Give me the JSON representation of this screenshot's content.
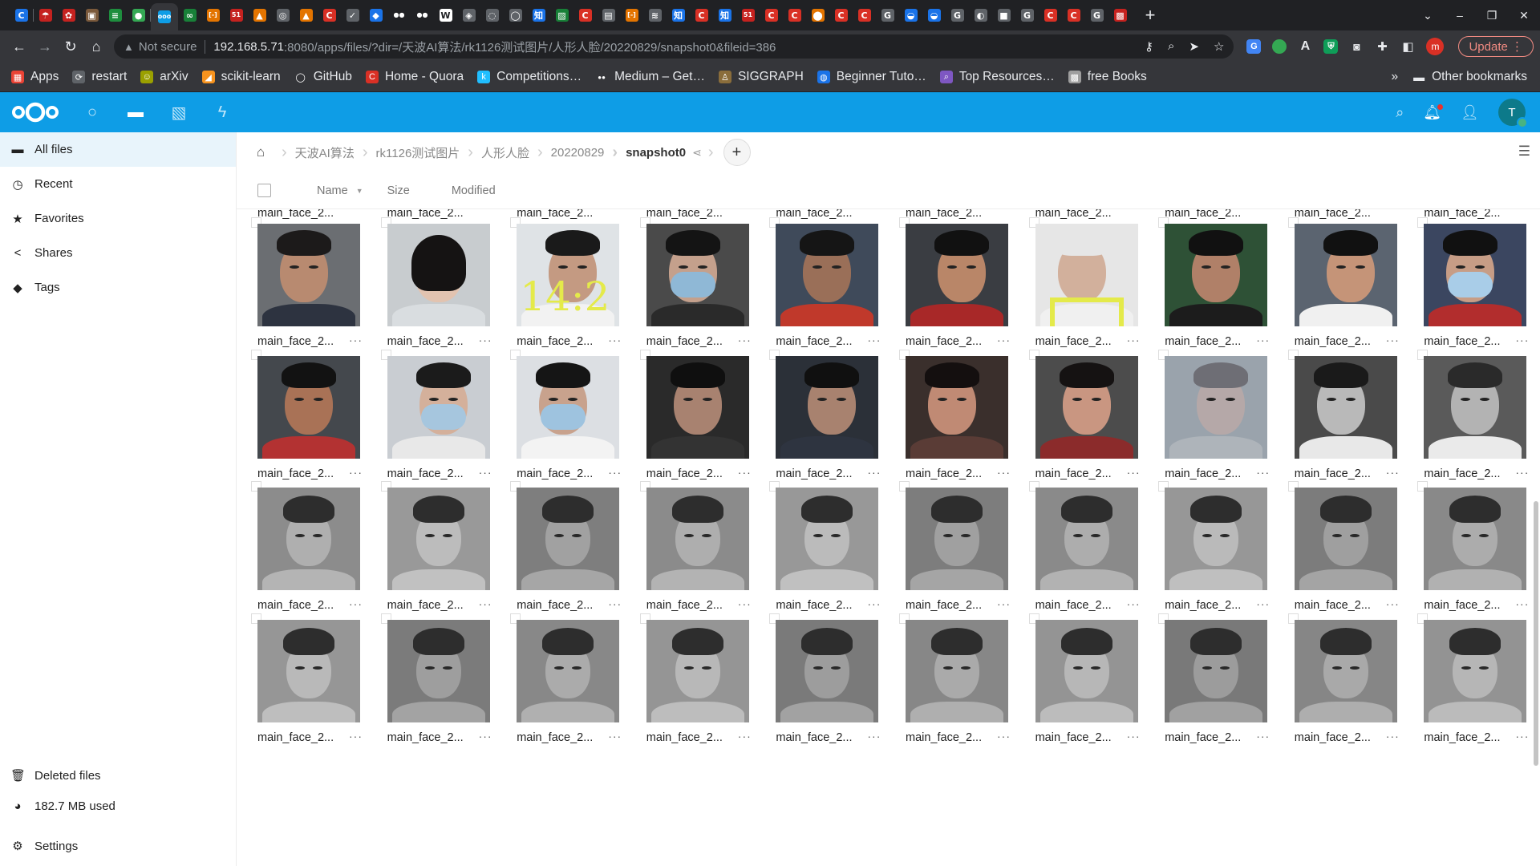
{
  "browser": {
    "tab_favicons": [
      {
        "label": "C",
        "color": "#1a73e8"
      },
      {
        "label": "☂",
        "color": "#c5221f"
      },
      {
        "label": "✿",
        "color": "#c5221f"
      },
      {
        "label": "▣",
        "color": "#7b5a3c"
      },
      {
        "label": "≡",
        "color": "#1e8e3e"
      },
      {
        "label": "●",
        "color": "#34a853"
      },
      {
        "label": "ooo",
        "color": "#0e9de6"
      },
      {
        "label": "∞",
        "color": "#188038"
      },
      {
        "label": "[-]",
        "color": "#e37400"
      },
      {
        "label": "51",
        "color": "#c5221f"
      },
      {
        "label": "▲",
        "color": "#e37400"
      },
      {
        "label": "◎",
        "color": "#5f6368"
      },
      {
        "label": "▲",
        "color": "#e37400"
      },
      {
        "label": "C",
        "color": "#d93025"
      },
      {
        "label": "✓",
        "color": "#5f6368"
      },
      {
        "label": "◆",
        "color": "#1a73e8"
      },
      {
        "label": "●●",
        "color": "#202124"
      },
      {
        "label": "●●",
        "color": "#202124"
      },
      {
        "label": "W",
        "color": "#fff"
      },
      {
        "label": "◈",
        "color": "#5f6368"
      },
      {
        "label": "◌",
        "color": "#5f6368"
      },
      {
        "label": "◯",
        "color": "#5f6368"
      },
      {
        "label": "知",
        "color": "#1a73e8"
      },
      {
        "label": "▨",
        "color": "#188038"
      },
      {
        "label": "C",
        "color": "#d93025"
      },
      {
        "label": "▤",
        "color": "#5f6368"
      },
      {
        "label": "[-]",
        "color": "#e37400"
      },
      {
        "label": "≋",
        "color": "#5f6368"
      },
      {
        "label": "知",
        "color": "#1a73e8"
      },
      {
        "label": "C",
        "color": "#d93025"
      },
      {
        "label": "知",
        "color": "#1a73e8"
      },
      {
        "label": "51",
        "color": "#c5221f"
      },
      {
        "label": "C",
        "color": "#d93025"
      },
      {
        "label": "C",
        "color": "#d93025"
      },
      {
        "label": "⬤",
        "color": "#e37400"
      },
      {
        "label": "C",
        "color": "#d93025"
      },
      {
        "label": "C",
        "color": "#d93025"
      },
      {
        "label": "G",
        "color": "#5f6368"
      },
      {
        "label": "◒",
        "color": "#1a73e8"
      },
      {
        "label": "◒",
        "color": "#1a73e8"
      },
      {
        "label": "G",
        "color": "#5f6368"
      },
      {
        "label": "◐",
        "color": "#5f6368"
      },
      {
        "label": "■",
        "color": "#5f6368"
      },
      {
        "label": "G",
        "color": "#5f6368"
      },
      {
        "label": "C",
        "color": "#d93025"
      },
      {
        "label": "C",
        "color": "#d93025"
      },
      {
        "label": "G",
        "color": "#5f6368"
      },
      {
        "label": "▩",
        "color": "#c5221f"
      }
    ],
    "active_tab_index": 6,
    "new_tab": "+",
    "window_controls": [
      "⌄",
      "–",
      "❐",
      "✕"
    ],
    "not_secure": "Not secure",
    "url_host": "192.168.5.71",
    "url_rest": ":8080/apps/files/?dir=/天波AI算法/rk1126测试图片/人形人脸/20220829/snapshot0&fileid=386",
    "profile_letter": "m",
    "update_label": "Update",
    "bookmarks": [
      {
        "label": "Apps",
        "icon": "▦",
        "color": "#ea4335"
      },
      {
        "label": "restart",
        "icon": "⟳",
        "color": "#5f6368"
      },
      {
        "label": "arXiv",
        "icon": "☺",
        "color": "#9aa000"
      },
      {
        "label": "scikit-learn",
        "icon": "◢",
        "color": "#f7931e"
      },
      {
        "label": "GitHub",
        "icon": "◯",
        "color": "#35363a"
      },
      {
        "label": "Home - Quora",
        "icon": "C",
        "color": "#d93025"
      },
      {
        "label": "Competitions…",
        "icon": "k",
        "color": "#20beff"
      },
      {
        "label": "Medium – Get…",
        "icon": "●●",
        "color": "#35363a"
      },
      {
        "label": "SIGGRAPH",
        "icon": "♙",
        "color": "#8a6d3b"
      },
      {
        "label": "Beginner Tuto…",
        "icon": "◍",
        "color": "#1a73e8"
      },
      {
        "label": "Top Resources…",
        "icon": "⌕",
        "color": "#7e57c2"
      },
      {
        "label": "free Books",
        "icon": "▩",
        "color": "#9e9e9e"
      }
    ],
    "bookmarks_more": "»",
    "other_bookmarks": "Other bookmarks"
  },
  "nextcloud": {
    "header_colors": {
      "primary": "#0e9de6"
    },
    "apps": [
      {
        "name": "dashboard-icon",
        "glyph": "○"
      },
      {
        "name": "files-icon",
        "glyph": "▬"
      },
      {
        "name": "photos-icon",
        "glyph": "▧"
      },
      {
        "name": "activity-icon",
        "glyph": "ϟ"
      }
    ],
    "avatar_letter": "T",
    "sidebar": {
      "items": [
        {
          "label": "All files",
          "icon": "▬"
        },
        {
          "label": "Recent",
          "icon": "◷"
        },
        {
          "label": "Favorites",
          "icon": "★"
        },
        {
          "label": "Shares",
          "icon": "<"
        },
        {
          "label": "Tags",
          "icon": "◆"
        }
      ],
      "deleted": "Deleted files",
      "quota": "182.7 MB used",
      "settings": "Settings"
    },
    "breadcrumb": [
      "天波AI算法",
      "rk1126测试图片",
      "人形人脸",
      "20220829",
      "snapshot0"
    ],
    "list_header": {
      "name": "Name",
      "size": "Size",
      "modified": "Modified"
    },
    "file_label": "main_face_2...",
    "more_label": "···"
  }
}
